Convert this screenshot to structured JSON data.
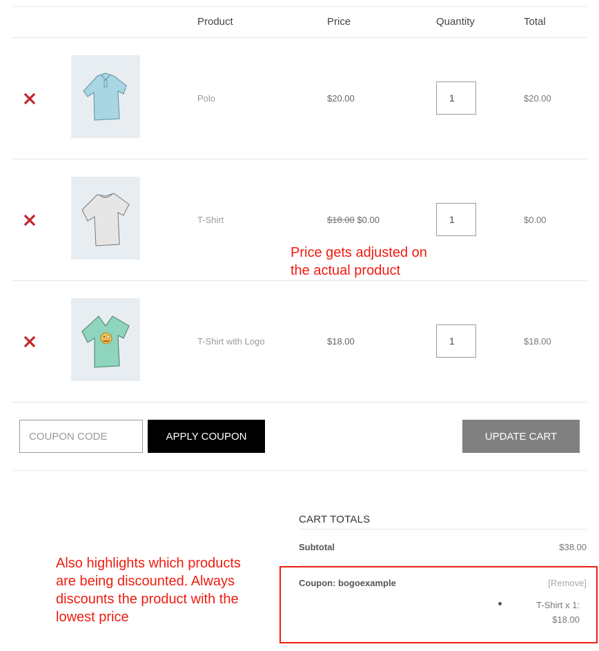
{
  "table": {
    "headers": {
      "product": "Product",
      "price": "Price",
      "quantity": "Quantity",
      "total": "Total"
    },
    "rows": [
      {
        "name": "Polo",
        "image": "polo-shirt-icon",
        "color": "#a9d6e3",
        "price_original": "",
        "price": "$20.00",
        "quantity": "1",
        "total": "$20.00"
      },
      {
        "name": "T-Shirt",
        "image": "tshirt-icon",
        "color": "#dcdcdc",
        "price_original": "$18.00",
        "price": "$0.00",
        "quantity": "1",
        "total": "$0.00"
      },
      {
        "name": "T-Shirt with Logo",
        "image": "tshirt-logo-icon",
        "color": "#8fd4bd",
        "price_original": "",
        "price": "$18.00",
        "quantity": "1",
        "total": "$18.00"
      }
    ],
    "remove_icon": "close-icon",
    "remove_color": "#c1272d"
  },
  "actions": {
    "coupon_placeholder": "COUPON CODE",
    "coupon_value": "",
    "apply_label": "APPLY COUPON",
    "update_label": "UPDATE CART"
  },
  "cart_totals": {
    "title": "CART TOTALS",
    "subtotal_label": "Subtotal",
    "subtotal_value": "$38.00",
    "coupon_label": "Coupon: bogoexample",
    "coupon_remove": "[Remove]",
    "discount_line1": "T-Shirt x 1:",
    "discount_line2": "$18.00"
  },
  "annotations": {
    "price_note_line1": "Price gets adjusted on",
    "price_note_line2": "the actual product",
    "highlight_note": [
      "Also highlights which products",
      "are being discounted. Always",
      "discounts the product with the",
      "lowest price"
    ],
    "color": "#ee1c10"
  }
}
